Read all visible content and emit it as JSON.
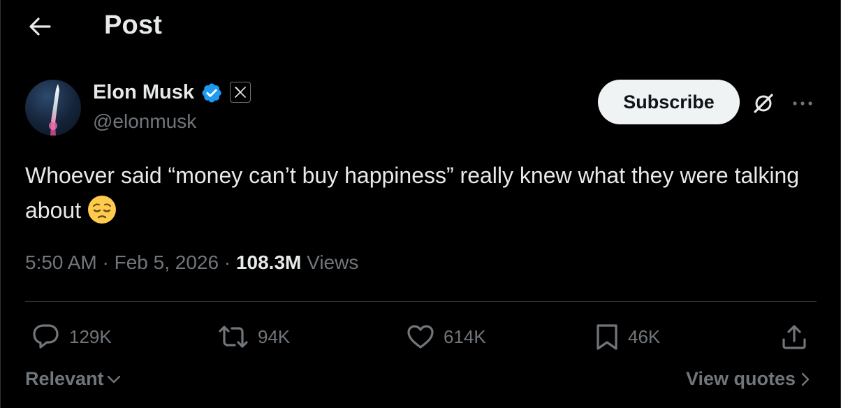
{
  "header": {
    "title": "Post"
  },
  "author": {
    "name": "Elon Musk",
    "handle": "@elonmusk",
    "affiliation": "X"
  },
  "actions_top": {
    "subscribe_label": "Subscribe"
  },
  "tweet": {
    "text": "Whoever said “money can’t buy happiness” really knew what they were talking about",
    "emoji": "pensive-face"
  },
  "meta": {
    "time": "5:50 AM",
    "sep1": " · ",
    "date": "Feb 5, 2026",
    "sep2": " · ",
    "views_count": "108.3M",
    "views_label": " Views"
  },
  "stats": {
    "replies": "129K",
    "reposts": "94K",
    "likes": "614K",
    "bookmarks": "46K"
  },
  "footer": {
    "sort_label": "Relevant",
    "quotes_label": "View quotes"
  },
  "colors": {
    "background": "#000000",
    "text": "#e7e9ea",
    "muted": "#71767b",
    "verified": "#1d9bf0",
    "divider": "#2f3336"
  }
}
